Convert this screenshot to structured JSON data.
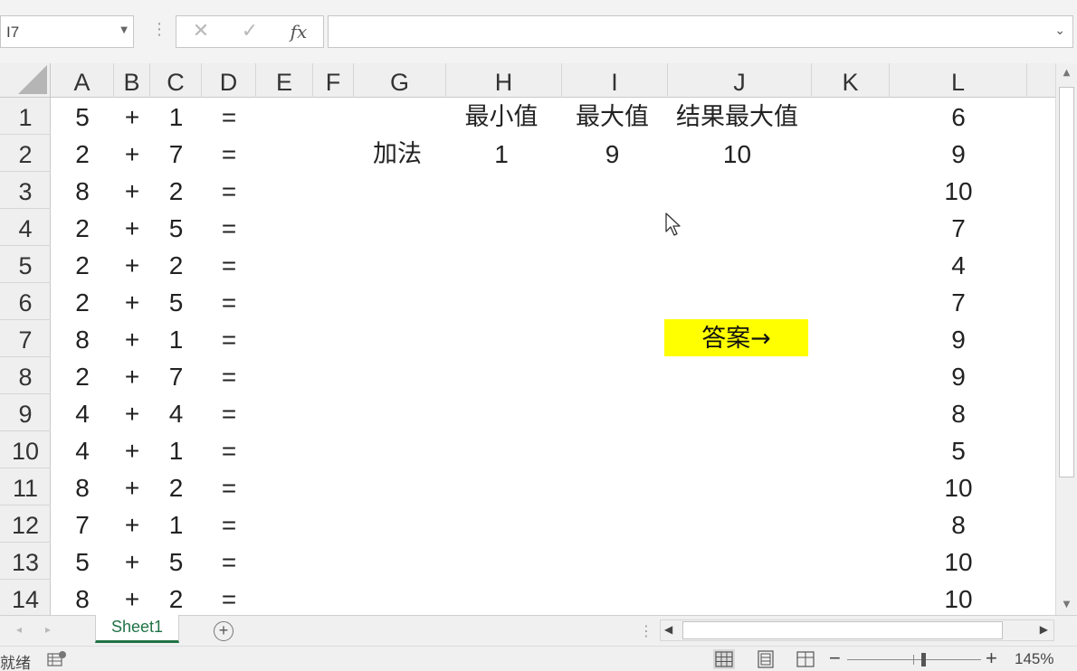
{
  "formula_bar": {
    "name_box": "I7",
    "cancel_icon": "✕",
    "enter_icon": "✓",
    "fx_icon": "fx",
    "formula_value": ""
  },
  "columns": [
    "A",
    "B",
    "C",
    "D",
    "E",
    "F",
    "G",
    "H",
    "I",
    "J",
    "K",
    "L"
  ],
  "rows": [
    "1",
    "2",
    "3",
    "4",
    "5",
    "6",
    "7",
    "8",
    "9",
    "10",
    "11",
    "12",
    "13",
    "14"
  ],
  "equations": [
    {
      "a": "5",
      "op": "+",
      "b": "1",
      "eq": "=",
      "answer": "6"
    },
    {
      "a": "2",
      "op": "+",
      "b": "7",
      "eq": "=",
      "answer": "9"
    },
    {
      "a": "8",
      "op": "+",
      "b": "2",
      "eq": "=",
      "answer": "10"
    },
    {
      "a": "2",
      "op": "+",
      "b": "5",
      "eq": "=",
      "answer": "7"
    },
    {
      "a": "2",
      "op": "+",
      "b": "2",
      "eq": "=",
      "answer": "4"
    },
    {
      "a": "2",
      "op": "+",
      "b": "5",
      "eq": "=",
      "answer": "7"
    },
    {
      "a": "8",
      "op": "+",
      "b": "1",
      "eq": "=",
      "answer": "9"
    },
    {
      "a": "2",
      "op": "+",
      "b": "7",
      "eq": "=",
      "answer": "9"
    },
    {
      "a": "4",
      "op": "+",
      "b": "4",
      "eq": "=",
      "answer": "8"
    },
    {
      "a": "4",
      "op": "+",
      "b": "1",
      "eq": "=",
      "answer": "5"
    },
    {
      "a": "8",
      "op": "+",
      "b": "2",
      "eq": "=",
      "answer": "10"
    },
    {
      "a": "7",
      "op": "+",
      "b": "1",
      "eq": "=",
      "answer": "8"
    },
    {
      "a": "5",
      "op": "+",
      "b": "5",
      "eq": "=",
      "answer": "10"
    },
    {
      "a": "8",
      "op": "+",
      "b": "2",
      "eq": "=",
      "answer": "10"
    }
  ],
  "settings": {
    "h1": "最小值",
    "i1": "最大值",
    "j1": "结果最大值",
    "g2": "加法",
    "h2": "1",
    "i2": "9",
    "j2": "10"
  },
  "answer_button": {
    "label": "答案→",
    "color": "#ffff00"
  },
  "sheet_tabs": {
    "active": "Sheet1",
    "add_icon": "+",
    "accent_color": "#217346"
  },
  "status_bar": {
    "status": "就绪",
    "zoom_out": "−",
    "zoom_in": "+",
    "zoom_level": "145%"
  }
}
